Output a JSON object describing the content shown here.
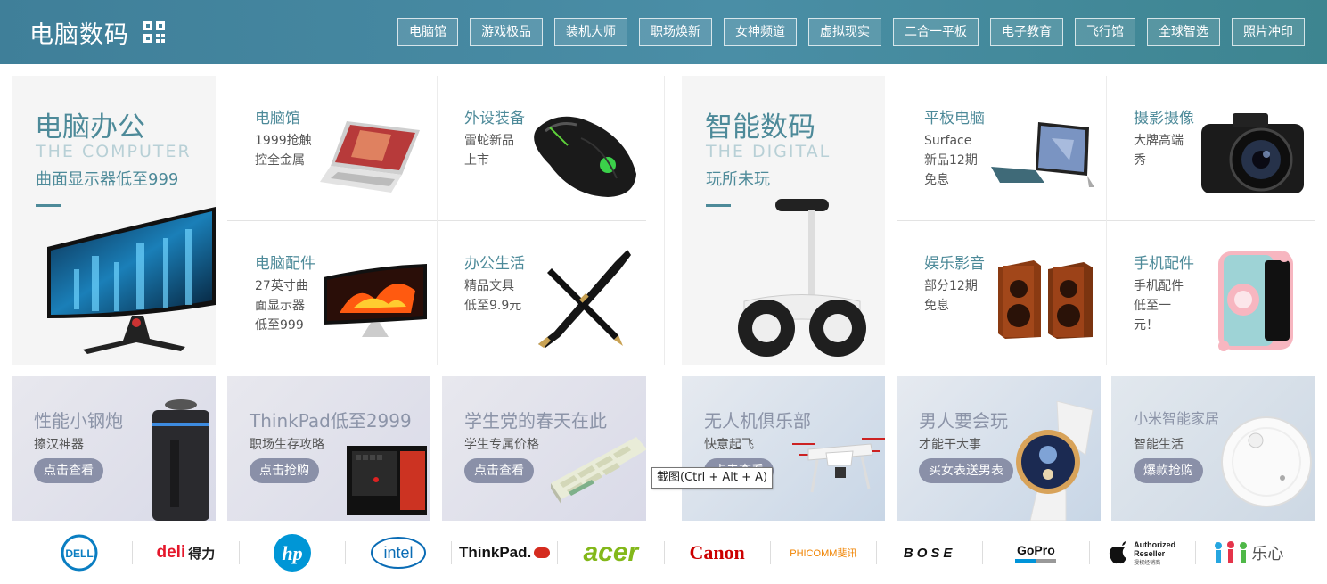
{
  "header": {
    "title": "电脑数码",
    "nav": [
      "电脑馆",
      "游戏极品",
      "装机大师",
      "职场焕新",
      "女神频道",
      "虚拟现实",
      "二合一平板",
      "电子教育",
      "飞行馆",
      "全球智选",
      "照片冲印"
    ]
  },
  "left_feature": {
    "title": "电脑办公",
    "en": "THE COMPUTER",
    "sub": "曲面显示器低至999"
  },
  "left_cells": [
    {
      "title": "电脑馆",
      "desc": "1999抢触控全金属"
    },
    {
      "title": "外设装备",
      "desc": "雷蛇新品上市"
    },
    {
      "title": "电脑配件",
      "desc": "27英寸曲面显示器低至999"
    },
    {
      "title": "办公生活",
      "desc": "精品文具低至9.9元"
    }
  ],
  "right_feature": {
    "title": "智能数码",
    "en": "THE DIGITAL",
    "sub": "玩所未玩"
  },
  "right_cells": [
    {
      "title": "平板电脑",
      "desc": "Surface新品12期免息"
    },
    {
      "title": "摄影摄像",
      "desc": "大牌高端秀"
    },
    {
      "title": "娱乐影音",
      "desc": "部分12期免息"
    },
    {
      "title": "手机配件",
      "desc": "手机配件低至一元！"
    }
  ],
  "promos": [
    {
      "title": "性能小钢炮",
      "sub": "擦汉神器",
      "btn": "点击查看"
    },
    {
      "title": "ThinkPad低至2999",
      "sub": "职场生存攻略",
      "btn": "点击抢购"
    },
    {
      "title": "学生党的春天在此",
      "sub": "学生专属价格",
      "btn": "点击查看"
    },
    {
      "title": "无人机俱乐部",
      "sub": "快意起飞",
      "btn": "点击查看"
    },
    {
      "title": "男人要会玩",
      "sub": "才能干大事",
      "btn": "买女表送男表"
    },
    {
      "title": "小米智能家居",
      "sub": "智能生活",
      "btn": "爆款抢购"
    }
  ],
  "tooltip": "截图(Ctrl + Alt + A)",
  "brands": {
    "dell": "DELL",
    "deli": "deli",
    "deli_cn": "得力",
    "hp": "hp",
    "intel": "intel",
    "thinkpad": "ThinkPad.",
    "acer": "acer",
    "canon": "Canon",
    "phicomm": "PHICOMM斐讯",
    "bose": "BOSE",
    "gopro": "GoPro",
    "apple_line1": "Authorized",
    "apple_line2": "Reseller",
    "apple_line3": "授权经销商",
    "lexin": "乐心"
  },
  "colors": {
    "header_bg": "#4a8ea6",
    "accent": "#4d8a99",
    "promo_btn": "#8a90a8"
  }
}
